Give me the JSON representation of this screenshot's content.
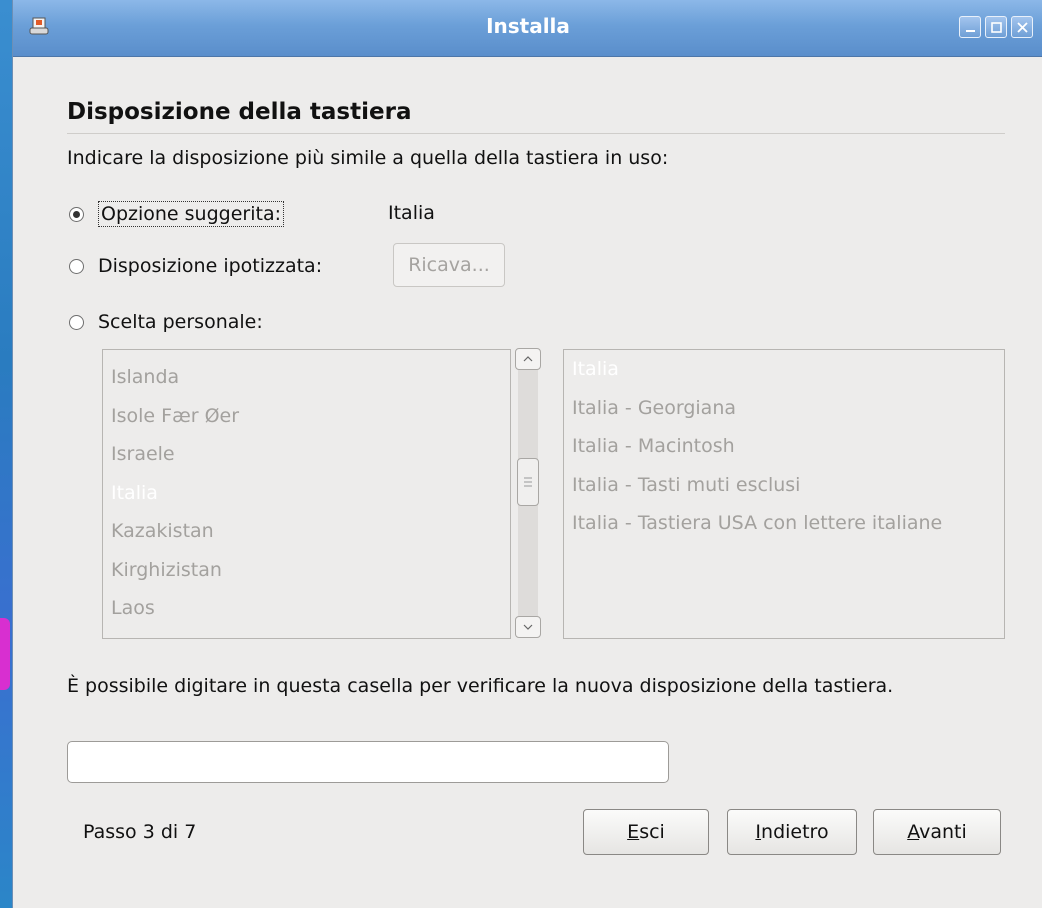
{
  "window": {
    "title": "Installa",
    "icons": [
      "installer-app-icon",
      "minimize-icon",
      "maximize-icon",
      "close-icon"
    ]
  },
  "page": {
    "heading": "Disposizione della tastiera",
    "prompt": "Indicare la disposizione più simile a quella della tastiera in uso:",
    "options": [
      {
        "label": "Opzione suggerita:",
        "value": "Italia",
        "checked": true
      },
      {
        "label": "Disposizione ipotizzata:",
        "button": "Ricava...",
        "checked": false
      },
      {
        "label": "Scelta personale:",
        "checked": false
      }
    ],
    "countries": [
      "Islanda",
      "Isole Fær Øer",
      "Israele",
      "Italia",
      "Kazakistan",
      "Kirghizistan",
      "Laos"
    ],
    "selected_country": "Italia",
    "variants": [
      "Italia",
      "Italia - Georgiana",
      "Italia - Macintosh",
      "Italia - Tasti muti esclusi",
      "Italia - Tastiera USA con lettere italiane"
    ],
    "selected_variant": "Italia",
    "hint": "È possibile digitare in questa casella per verificare la nuova disposizione della tastiera.",
    "test_value": ""
  },
  "footer": {
    "step": "Passo 3 di 7",
    "quit": {
      "pre": "",
      "mnemonic": "E",
      "post": "sci"
    },
    "back": {
      "pre": "",
      "mnemonic": "I",
      "post": "ndietro"
    },
    "forward": {
      "pre": "",
      "mnemonic": "A",
      "post": "vanti"
    }
  }
}
